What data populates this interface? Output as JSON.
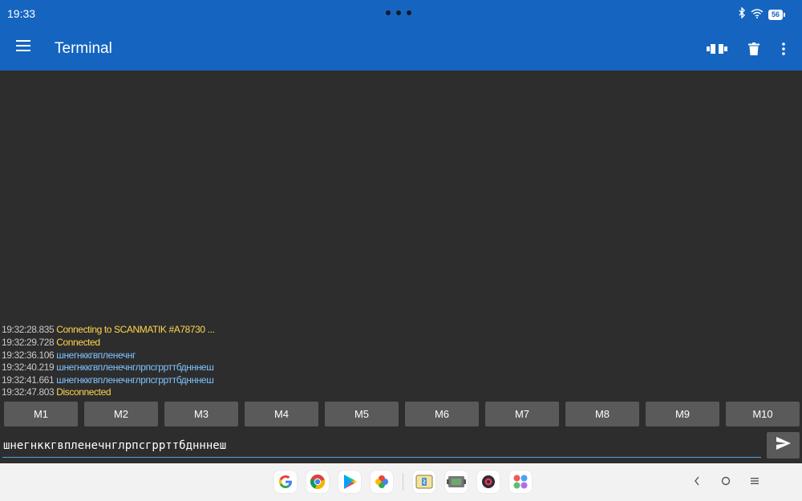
{
  "status_bar": {
    "time": "19:33",
    "battery": "56"
  },
  "app_bar": {
    "title": "Terminal"
  },
  "log": [
    {
      "ts": "19:32:28.835",
      "msg": "Connecting to SCANMATIK #A78730 ...",
      "kind": "status"
    },
    {
      "ts": "19:32:29.728",
      "msg": "Connected",
      "kind": "status"
    },
    {
      "ts": "19:32:36.106",
      "msg": "шнегнккгвпленечнг",
      "kind": "data"
    },
    {
      "ts": "19:32:40.219",
      "msg": "шнегнккгвпленечнглрпсгррттбднннеш",
      "kind": "data"
    },
    {
      "ts": "19:32:41.661",
      "msg": "шнегнккгвпленечнглрпсгррттбднннеш",
      "kind": "data"
    },
    {
      "ts": "19:32:47.803",
      "msg": "Disconnected",
      "kind": "status"
    }
  ],
  "macros": [
    "M1",
    "M2",
    "M3",
    "M4",
    "M5",
    "M6",
    "M7",
    "M8",
    "M9",
    "M10"
  ],
  "input": {
    "value": "шнегнккгвпленечнглрпсгррттбднннеш"
  },
  "colors": {
    "accent": "#1565c0",
    "status_text": "#ffd54f",
    "data_text": "#7fc4ff"
  }
}
